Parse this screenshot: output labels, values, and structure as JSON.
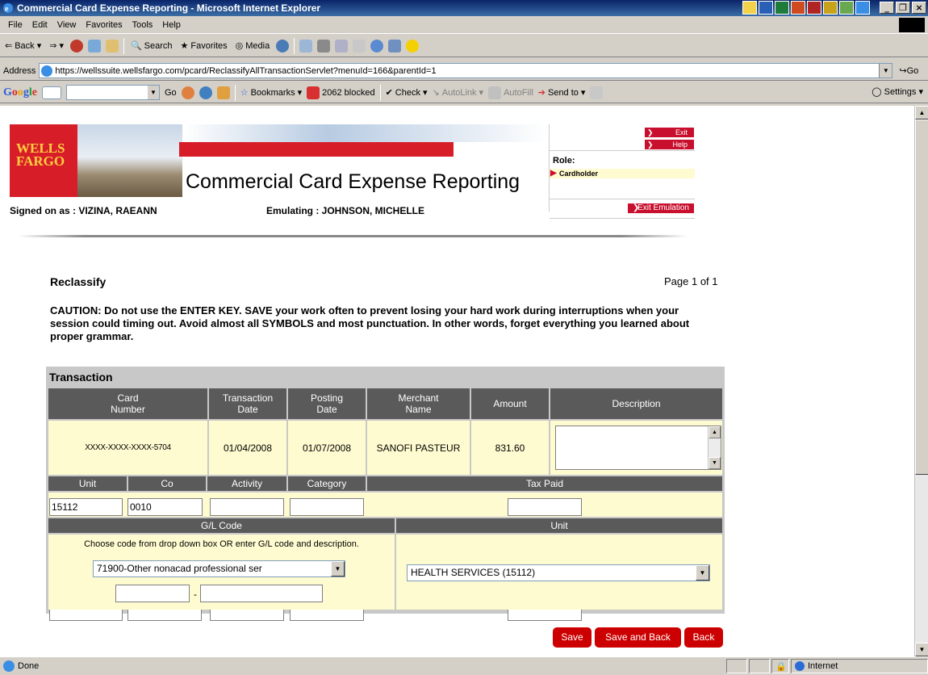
{
  "window": {
    "title": "Commercial Card Expense Reporting - Microsoft Internet Explorer",
    "controls": {
      "minimize": "_",
      "restore": "&#x25A1;",
      "close": "x"
    }
  },
  "menu": [
    "File",
    "Edit",
    "View",
    "Favorites",
    "Tools",
    "Help"
  ],
  "toolbar": {
    "back": "Back",
    "search": "Search",
    "favorites": "Favorites",
    "media": "Media"
  },
  "address": {
    "label": "Address",
    "url": "https://wellssuite.wellsfargo.com/pcard/ReclassifyAllTransactionServlet?menuId=166&parentId=1",
    "go": "Go"
  },
  "google": {
    "logo": [
      "G",
      "o",
      "o",
      "g",
      "l",
      "e"
    ],
    "go": "Go",
    "bookmarks": "Bookmarks",
    "blocked": "2062 blocked",
    "check": "Check",
    "autolink": "AutoLink",
    "autofill": "AutoFill",
    "sendto": "Send to",
    "settings": "Settings"
  },
  "header": {
    "logo_line1": "WELLS",
    "logo_line2": "FARGO",
    "app_title": "Commercial Card Expense Reporting",
    "signed_on": "Signed on as : VIZINA, RAEANN",
    "emulating": "Emulating : JOHNSON, MICHELLE",
    "exit": "Exit",
    "help": "Help",
    "role_label": "Role:",
    "role_value": "Cardholder",
    "exit_emulation": "Exit Emulation"
  },
  "page": {
    "title": "Reclassify",
    "page_info": "Page 1 of 1",
    "caution": "CAUTION: Do not use the ENTER KEY. SAVE your work often to prevent losing your hard work during interruptions when your session could timing out.  Avoid almost all SYMBOLS and most punctuation. In other words, forget everything you learned about proper grammar."
  },
  "transaction": {
    "section_title": "Transaction",
    "headers": {
      "card_number": "Card\nNumber",
      "transaction_date": "Transaction\nDate",
      "posting_date": "Posting\nDate",
      "merchant_name": "Merchant\nName",
      "amount": "Amount",
      "description": "Description"
    },
    "row": {
      "card_number": "XXXX-XXXX-XXXX-5704",
      "transaction_date": "01/04/2008",
      "posting_date": "01/07/2008",
      "merchant_name": "SANOFI PASTEUR",
      "amount": "831.60",
      "description": ""
    },
    "headers2": {
      "unit": "Unit",
      "co": "Co",
      "activity": "Activity",
      "category": "Category",
      "tax_paid": "Tax Paid"
    },
    "values2": {
      "unit": "15112",
      "co": "0010",
      "activity": "",
      "category": "",
      "tax_paid": ""
    },
    "gl_header": "G/L Code",
    "unit_header": "Unit",
    "gl_instruction": "Choose code from drop down box OR enter G/L code and description.",
    "gl_selected": "71900-Other nonacad professional ser",
    "gl_code": "",
    "gl_separator": "-",
    "gl_description": "",
    "unit_selected": "HEALTH SERVICES (15112)"
  },
  "actions": {
    "save": "Save",
    "save_and_back": "Save and Back",
    "back": "Back"
  },
  "status": {
    "text": "Done",
    "zone": "Internet"
  }
}
